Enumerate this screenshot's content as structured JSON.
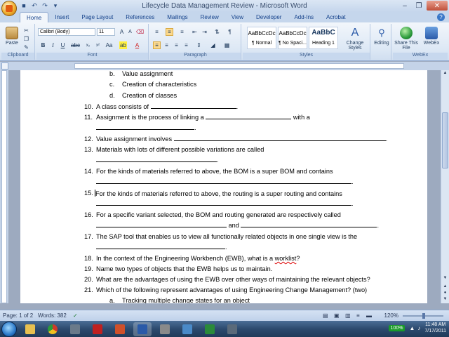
{
  "window": {
    "title": "Lifecycle Data Management Review - Microsoft Word"
  },
  "tabs": [
    "Home",
    "Insert",
    "Page Layout",
    "References",
    "Mailings",
    "Review",
    "View",
    "Developer",
    "Add-Ins",
    "Acrobat"
  ],
  "ribbon": {
    "clipboard": {
      "label": "Clipboard",
      "paste": "Paste"
    },
    "font": {
      "label": "Font",
      "name": "Calibri (Body)",
      "size": "11"
    },
    "paragraph": {
      "label": "Paragraph"
    },
    "styles": {
      "label": "Styles",
      "items": [
        {
          "sample": "AaBbCcDc",
          "name": "¶ Normal"
        },
        {
          "sample": "AaBbCcDc",
          "name": "¶ No Spaci..."
        },
        {
          "sample": "AaBbC",
          "name": "Heading 1"
        }
      ],
      "change_styles": "Change Styles"
    },
    "editing": {
      "label": "Editing"
    },
    "webex": {
      "label": "WebEx",
      "share": "Share This File",
      "webex_btn": "WebEx"
    }
  },
  "document": {
    "lines": [
      {
        "num": "b.",
        "text": "Value assignment"
      },
      {
        "num": "c.",
        "text": "Creation of characteristics"
      },
      {
        "num": "d.",
        "text": "Creation of classes"
      },
      {
        "num": "10.",
        "text": "A class consists of"
      },
      {
        "num": "11.",
        "text": "Assignment is the process of linking a",
        "text2": "with a"
      },
      {
        "num": "12.",
        "text": "Value assignment involves"
      },
      {
        "num": "13.",
        "text": "Materials with lots of different possible variations are called"
      },
      {
        "num": "14.",
        "text": "For the kinds of materials referred to above, the BOM is a super BOM and contains"
      },
      {
        "num": "15.",
        "text": "For the kinds of materials referred to above, the routing is a super routing and contains"
      },
      {
        "num": "16.",
        "text": "For a specific variant selected, the BOM and routing generated are respectively called"
      },
      {
        "num": "",
        "text": "and"
      },
      {
        "num": "17.",
        "text": "The SAP tool that enables us to view all functionally related objects in one single view is the"
      },
      {
        "num": "18.",
        "text": "In the context of the Engineering Workbench (EWB), what is a",
        "wavy": "worklist",
        "text2": "?"
      },
      {
        "num": "19.",
        "text": "Name two types of objects that the EWB helps us to maintain."
      },
      {
        "num": "20.",
        "text": "What are the advantages of using the EWB over other ways of maintaining the relevant objects?"
      },
      {
        "num": "21.",
        "text": "Which of the following represent advantages of using Engineering Change Management? (two)"
      },
      {
        "num": "a.",
        "text": "Tracking multiple change states for an object"
      }
    ]
  },
  "statusbar": {
    "page": "Page: 1 of 2",
    "words": "Words: 382",
    "zoom": "120%"
  },
  "taskbar": {
    "battery": "100%",
    "time": "11:48 AM",
    "date": "7/17/2011"
  }
}
